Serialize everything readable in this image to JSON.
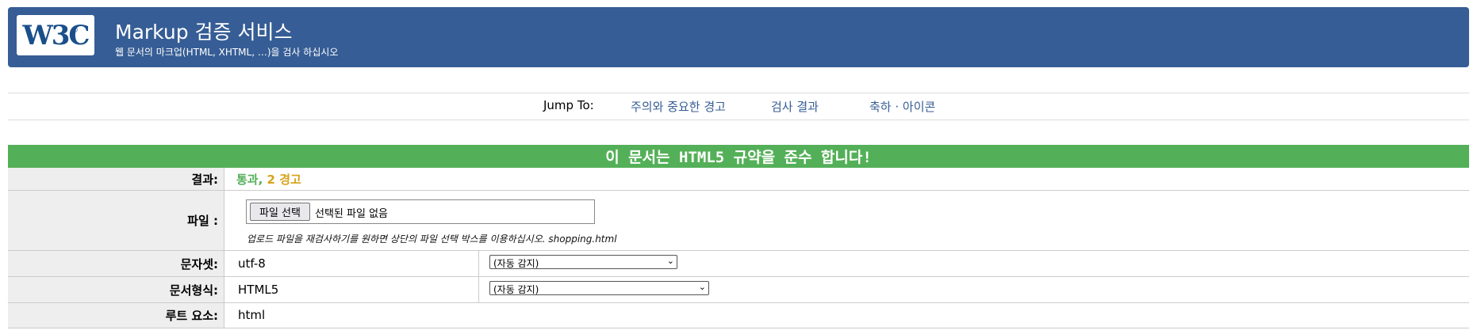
{
  "header": {
    "logo_text": "W3C",
    "logo_reg": "®",
    "title": "Markup 검증 서비스",
    "subtitle": "웹 문서의 마크업(HTML, XHTML, …)을 검사 하십시오"
  },
  "jump": {
    "label": "Jump To:",
    "links": [
      "주의와 중요한 경고",
      "검사 결과",
      "축하 · 아이콘"
    ]
  },
  "result": {
    "headline": "이 문서는 HTML5 규약을 준수 합니다!",
    "rows": {
      "result": {
        "label": "결과:",
        "pass": "통과,",
        "warnings": "2 경고"
      },
      "file": {
        "label": "파일 :",
        "button": "파일 선택",
        "status": "선택된 파일 없음",
        "help": "업로드 파일을 재검사하기를 원하면 상단의 파일 선택 박스를 이용하십시오. shopping.html"
      },
      "charset": {
        "label": "문자셋:",
        "value": "utf-8",
        "select": "(자동 감지)"
      },
      "doctype": {
        "label": "문서형식:",
        "value": "HTML5",
        "select": "(자동 감지)"
      },
      "root": {
        "label": "루트 요소:",
        "value": "html"
      }
    }
  },
  "colors": {
    "banner": "#365d95",
    "pass_green": "#54b058",
    "warning_gold": "#d6a319",
    "link": "#365d95"
  },
  "icons": {
    "dropdown": "chevron-down-icon"
  }
}
